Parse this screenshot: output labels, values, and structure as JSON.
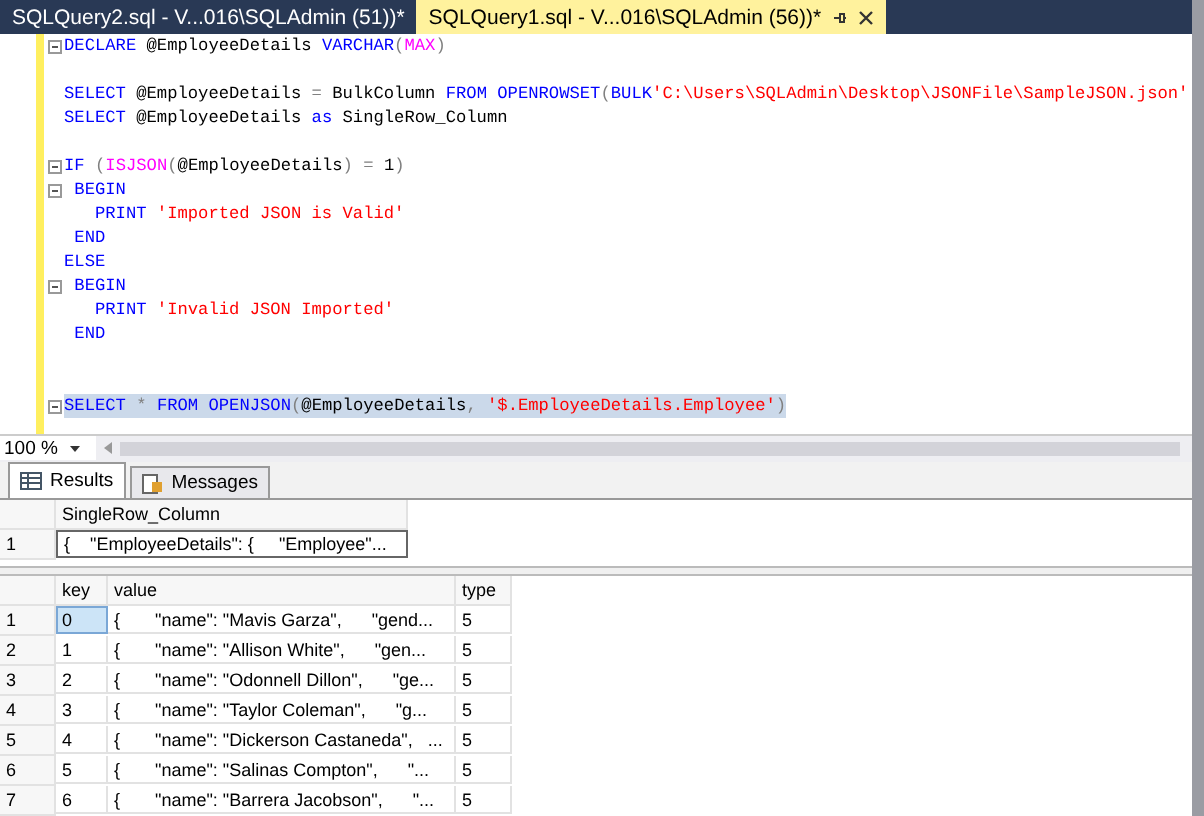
{
  "tabs": [
    {
      "label": "SQLQuery2.sql - V...016\\SQLAdmin (51))*",
      "selected": false
    },
    {
      "label": "SQLQuery1.sql - V...016\\SQLAdmin (56))*",
      "selected": true
    }
  ],
  "editor": {
    "lines": [
      {
        "kind": "code",
        "fold": true,
        "segments": [
          {
            "kind": "kw",
            "text": "DECLARE "
          },
          {
            "kind": "plain",
            "text": "@EmployeeDetails "
          },
          {
            "kind": "kw",
            "text": "VARCHAR"
          },
          {
            "kind": "op",
            "text": "("
          },
          {
            "kind": "fn",
            "text": "MAX"
          },
          {
            "kind": "op",
            "text": ")"
          }
        ]
      },
      {
        "kind": "blank"
      },
      {
        "kind": "code",
        "segments": [
          {
            "kind": "kw",
            "text": "SELECT "
          },
          {
            "kind": "plain",
            "text": "@EmployeeDetails "
          },
          {
            "kind": "op",
            "text": "= "
          },
          {
            "kind": "plain",
            "text": "BulkColumn "
          },
          {
            "kind": "kw",
            "text": "FROM "
          },
          {
            "kind": "kw",
            "text": "OPENROWSET"
          },
          {
            "kind": "op",
            "text": "("
          },
          {
            "kind": "kw",
            "text": "BULK"
          },
          {
            "kind": "str",
            "text": "'C:\\Users\\SQLAdmin\\Desktop\\JSONFile\\SampleJSON.json'"
          }
        ]
      },
      {
        "kind": "code",
        "segments": [
          {
            "kind": "kw",
            "text": "SELECT "
          },
          {
            "kind": "plain",
            "text": "@EmployeeDetails "
          },
          {
            "kind": "kw",
            "text": "as "
          },
          {
            "kind": "plain",
            "text": "SingleRow_Column"
          }
        ]
      },
      {
        "kind": "blank"
      },
      {
        "kind": "code",
        "fold": true,
        "segments": [
          {
            "kind": "kw",
            "text": "IF "
          },
          {
            "kind": "op",
            "text": "("
          },
          {
            "kind": "fn",
            "text": "ISJSON"
          },
          {
            "kind": "op",
            "text": "("
          },
          {
            "kind": "plain",
            "text": "@EmployeeDetails"
          },
          {
            "kind": "op",
            "text": ") = "
          },
          {
            "kind": "plain",
            "text": "1"
          },
          {
            "kind": "op",
            "text": ")"
          }
        ]
      },
      {
        "kind": "code",
        "fold": true,
        "segments": [
          {
            "kind": "kw",
            "text": " BEGIN"
          }
        ]
      },
      {
        "kind": "code",
        "segments": [
          {
            "kind": "kw",
            "text": "   PRINT "
          },
          {
            "kind": "str",
            "text": "'Imported JSON is Valid'"
          }
        ]
      },
      {
        "kind": "code",
        "segments": [
          {
            "kind": "kw",
            "text": " END"
          }
        ]
      },
      {
        "kind": "code",
        "segments": [
          {
            "kind": "kw",
            "text": "ELSE"
          }
        ]
      },
      {
        "kind": "code",
        "fold": true,
        "segments": [
          {
            "kind": "kw",
            "text": " BEGIN"
          }
        ]
      },
      {
        "kind": "code",
        "segments": [
          {
            "kind": "kw",
            "text": "   PRINT "
          },
          {
            "kind": "str",
            "text": "'Invalid JSON Imported'"
          }
        ]
      },
      {
        "kind": "code",
        "segments": [
          {
            "kind": "kw",
            "text": " END"
          }
        ]
      },
      {
        "kind": "blank"
      },
      {
        "kind": "blank"
      },
      {
        "kind": "code",
        "fold": true,
        "highlighted": true,
        "segments": [
          {
            "kind": "kw",
            "text": "SELECT "
          },
          {
            "kind": "op",
            "text": "* "
          },
          {
            "kind": "kw",
            "text": "FROM "
          },
          {
            "kind": "kw",
            "text": "OPENJSON"
          },
          {
            "kind": "op",
            "text": "("
          },
          {
            "kind": "plain",
            "text": "@EmployeeDetails"
          },
          {
            "kind": "op",
            "text": ", "
          },
          {
            "kind": "str",
            "text": "'$.EmployeeDetails.Employee'"
          },
          {
            "kind": "op",
            "text": ")"
          }
        ]
      },
      {
        "kind": "blank"
      }
    ]
  },
  "zoom": {
    "value": "100 %"
  },
  "result_tabs": [
    {
      "label": "Results",
      "selected": true
    },
    {
      "label": "Messages",
      "selected": false
    }
  ],
  "grid_1": {
    "columns": [
      "SingleRow_Column"
    ],
    "rows": [
      {
        "number": "1",
        "cells": [
          "{    \"EmployeeDetails\": {     \"Employee\"..."
        ]
      }
    ]
  },
  "grid_2": {
    "columns": [
      "key",
      "value",
      "type"
    ],
    "rows": [
      {
        "number": "1",
        "selected": true,
        "cells": [
          "0",
          "{       \"name\": \"Mavis Garza\",      \"gend...",
          "5"
        ]
      },
      {
        "number": "2",
        "selected": false,
        "cells": [
          "1",
          "{       \"name\": \"Allison White\",      \"gen...",
          "5"
        ]
      },
      {
        "number": "3",
        "selected": false,
        "cells": [
          "2",
          "{       \"name\": \"Odonnell Dillon\",      \"ge...",
          "5"
        ]
      },
      {
        "number": "4",
        "selected": false,
        "cells": [
          "3",
          "{       \"name\": \"Taylor Coleman\",      \"g...",
          "5"
        ]
      },
      {
        "number": "5",
        "selected": false,
        "cells": [
          "4",
          "{       \"name\": \"Dickerson Castaneda\",   ...",
          "5"
        ]
      },
      {
        "number": "6",
        "selected": false,
        "cells": [
          "5",
          "{       \"name\": \"Salinas Compton\",      \"...",
          "5"
        ]
      },
      {
        "number": "7",
        "selected": false,
        "cells": [
          "6",
          "{       \"name\": \"Barrera Jacobson\",      \"...",
          "5"
        ]
      }
    ]
  }
}
